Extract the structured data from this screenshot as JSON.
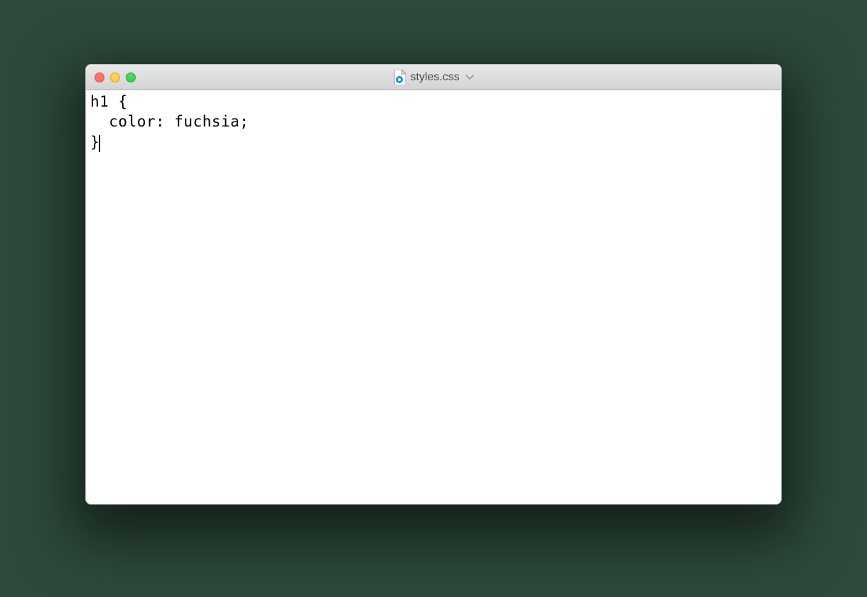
{
  "window": {
    "filename": "styles.css"
  },
  "editor": {
    "lines": [
      "h1 {",
      "  color: fuchsia;",
      "}"
    ]
  }
}
